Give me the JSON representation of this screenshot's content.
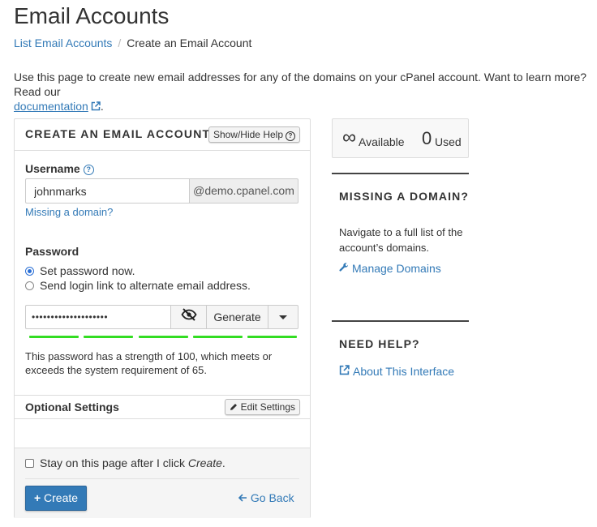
{
  "page": {
    "title": "Email Accounts",
    "breadcrumb": {
      "link": "List Email Accounts",
      "separator": "/",
      "current": "Create an Email Account"
    },
    "intro": {
      "text": "Use this page to create new email addresses for any of the domains on your cPanel account. Want to learn more? Read our",
      "link": "documentation",
      "tail": "."
    }
  },
  "form": {
    "heading": "CREATE AN EMAIL ACCOUNT",
    "help_button": "Show/Hide Help",
    "username": {
      "label": "Username",
      "value": "johnmarks",
      "domain": "@demo.cpanel.com",
      "missing_domain_link": "Missing a domain?"
    },
    "password": {
      "label": "Password",
      "options": [
        {
          "label": "Set password now.",
          "checked": true
        },
        {
          "label": "Send login link to alternate email address.",
          "checked": false
        }
      ],
      "masked_value": "••••••••••••••••••••",
      "generate_label": "Generate",
      "strength_segments": 5,
      "strength_text": "This password has a strength of 100, which meets or exceeds the system requirement of 65."
    },
    "optional": {
      "label": "Optional Settings",
      "edit_button": "Edit Settings"
    },
    "stay": {
      "label_prefix": "Stay on this page after I click ",
      "label_em": "Create",
      "label_suffix": ".",
      "checked": false
    },
    "create_button": "Create",
    "go_back": "Go Back"
  },
  "sidebar": {
    "stats": {
      "available_symbol": "∞",
      "available_label": "Available",
      "used_count": "0",
      "used_label": "Used"
    },
    "missing_domain": {
      "heading": "MISSING A DOMAIN?",
      "text": "Navigate to a full list of the account’s domains.",
      "link": "Manage Domains"
    },
    "need_help": {
      "heading": "NEED HELP?",
      "link": "About This Interface"
    }
  },
  "colors": {
    "link": "#337ab7",
    "primary_button": "#337ab7",
    "strength_bar": "#33dd22"
  }
}
